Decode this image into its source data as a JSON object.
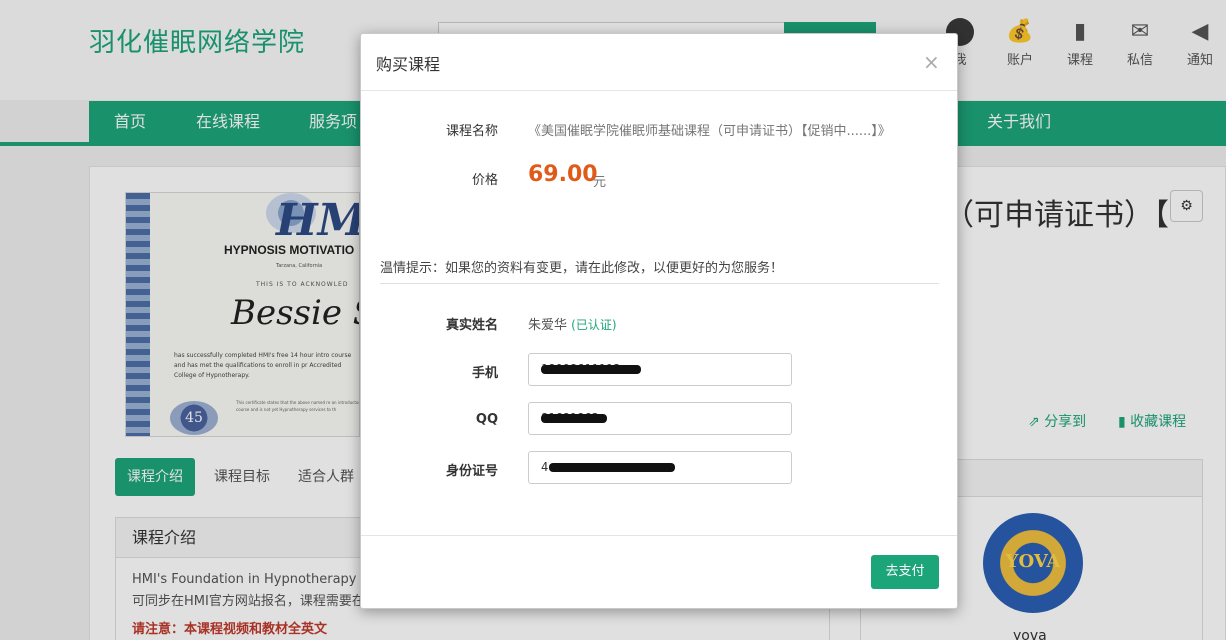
{
  "site": {
    "brand": "羽化催眠网络学院",
    "search_icon": "search-icon"
  },
  "top_icons": [
    {
      "label": "我",
      "icon": "avatar"
    },
    {
      "label": "账户",
      "icon": "money-bag-icon"
    },
    {
      "label": "课程",
      "icon": "book-icon"
    },
    {
      "label": "私信",
      "icon": "envelope-icon"
    },
    {
      "label": "通知",
      "icon": "speaker-icon"
    }
  ],
  "nav": {
    "items": [
      "首页",
      "在线课程",
      "服务项",
      "关于我们"
    ]
  },
  "course": {
    "title_fragment": "（可申请证书）【",
    "share": "分享到",
    "favorite": "收藏课程",
    "certificate": {
      "logo": "HMI",
      "title": "HYPNOSIS MOTIVATIO",
      "subtitle": "Tarzana, California",
      "acknowledge": "THIS IS TO ACKNOWLED",
      "name": "Bessie S",
      "body": "has successfully completed HMI's free 14 hour intro course and has met the qualifications to enroll in pr Accredited College of Hypnotherapy.",
      "fine_print": "This certificate states that the above named re an introductory course and is not yet Hypnotherapy services to th",
      "seal": "45"
    }
  },
  "tabs": [
    {
      "label": "课程介绍",
      "active": true
    },
    {
      "label": "课程目标",
      "active": false
    },
    {
      "label": "适合人群",
      "active": false
    }
  ],
  "intro": {
    "heading": "课程介绍",
    "line1": "HMI's Foundation in Hypnotherapy C",
    "line2": "可同步在HMI官方网站报名，课程需要在",
    "warning": "请注意：本课程视频和教材全英文"
  },
  "sidebar": {
    "logo_text": "YOVA",
    "name": "yova"
  },
  "modal": {
    "title": "购买课程",
    "close": "×",
    "course_label": "课程名称",
    "course_name": "《美国催眠学院催眠师基础课程（可申请证书）【促销中......】》",
    "price_label": "价格",
    "price": "69.00",
    "currency": "元",
    "tip": "温情提示：如果您的资料有变更，请在此修改，以便更好的为您服务！",
    "realname_label": "真实姓名",
    "realname": "朱爱华",
    "verified": "(已认证)",
    "phone_label": "手机",
    "phone_value": "18008611113",
    "qq_label": "QQ",
    "qq_value": "81681863",
    "id_label": "身份证号",
    "id_value": "4",
    "pay_button": "去支付"
  },
  "colors": {
    "brand_green": "#1da57a",
    "price_orange": "#e05a1a",
    "warning_red": "#c0392b"
  }
}
